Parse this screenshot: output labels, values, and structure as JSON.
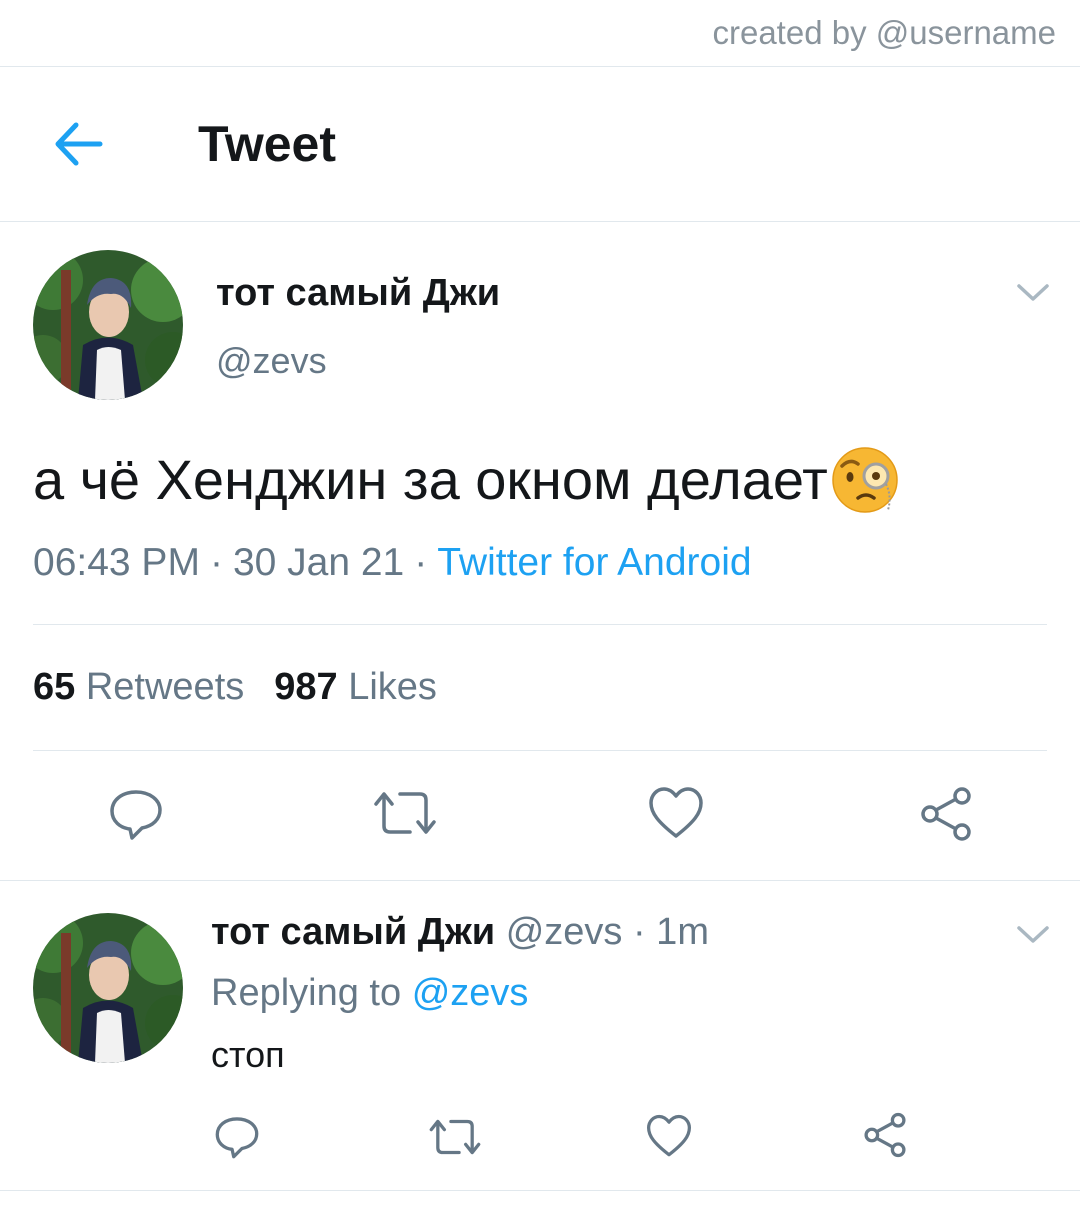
{
  "credit": "created by @username",
  "header": {
    "back_icon": "arrow-left-icon",
    "title": "Tweet"
  },
  "tweet": {
    "name": "тот самый Джи",
    "handle": "@zevs",
    "text": "а чё Хенджин за окном делает",
    "emoji": "face-with-monocle",
    "time": "06:43 PM",
    "separator": "·",
    "date": "30 Jan 21",
    "source": "Twitter for Android",
    "retweets_count": "65",
    "retweets_label": "Retweets",
    "likes_count": "987",
    "likes_label": "Likes"
  },
  "reply": {
    "name": "тот самый Джи",
    "handle_time": "@zevs · 1m",
    "replying_prefix": "Replying to",
    "replying_mention": "@zevs",
    "text": "стоп"
  },
  "icons": {
    "reply": "comment-icon",
    "retweet": "retweet-icon",
    "like": "heart-icon",
    "share": "share-icon",
    "menu": "chevron-down-icon"
  },
  "colors": {
    "accent": "#1da1f2",
    "muted": "#657786",
    "divider": "#e1e8ed"
  }
}
